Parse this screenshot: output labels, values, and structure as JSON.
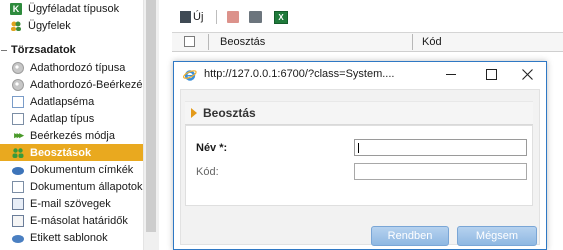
{
  "sidebar": {
    "top_items": [
      {
        "label": "Ügyféladat típusok",
        "icon": "customer-data-types-icon"
      },
      {
        "label": "Ügyfelek",
        "icon": "customers-icon"
      }
    ],
    "section": {
      "label": "Törzsadatok"
    },
    "items": [
      {
        "label": "Adathordozó típusa",
        "icon": "media-type-icon"
      },
      {
        "label": "Adathordozó-Beérkezés",
        "icon": "media-receipt-icon"
      },
      {
        "label": "Adatlapséma",
        "icon": "datasheet-schema-icon"
      },
      {
        "label": "Adatlap típus",
        "icon": "datasheet-type-icon"
      },
      {
        "label": "Beérkezés módja",
        "icon": "receipt-method-icon"
      },
      {
        "label": "Beosztások",
        "icon": "positions-icon",
        "selected": true
      },
      {
        "label": "Dokumentum címkék",
        "icon": "document-tags-icon"
      },
      {
        "label": "Dokumentum állapotok",
        "icon": "document-states-icon"
      },
      {
        "label": "E-mail szövegek",
        "icon": "email-texts-icon"
      },
      {
        "label": "E-másolat határidők",
        "icon": "e-copy-deadlines-icon"
      },
      {
        "label": "Etikett sablonok",
        "icon": "label-templates-icon"
      }
    ]
  },
  "toolbar": {
    "new_label": "Új",
    "icons": [
      "new-icon",
      "delete-icon",
      "print-icon",
      "excel-export-icon"
    ]
  },
  "grid": {
    "columns": [
      "Beosztás",
      "Kód"
    ]
  },
  "dialog": {
    "url": "http://127.0.0.1:6700/?class=System....",
    "panel_title": "Beosztás",
    "fields": [
      {
        "label": "Név *:",
        "value": "",
        "required": true
      },
      {
        "label": "Kód:",
        "value": "",
        "required": false
      }
    ],
    "ok_label": "Rendben",
    "cancel_label": "Mégsem"
  },
  "colors": {
    "accent_selected": "#e9a91f",
    "dialog_border": "#2f78c4",
    "button": "#9dc2e8"
  }
}
